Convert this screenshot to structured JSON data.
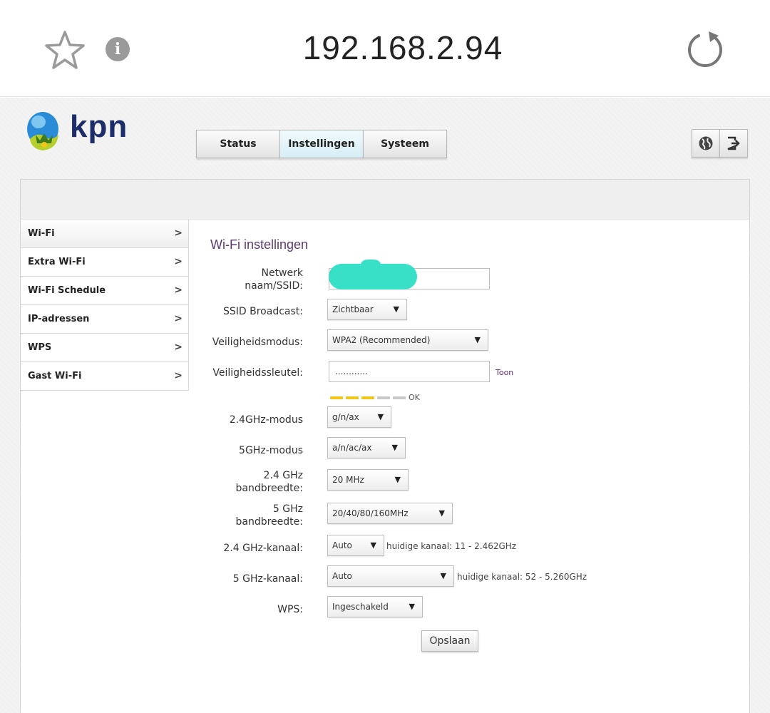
{
  "browser": {
    "url": "192.168.2.94",
    "star_icon": "star-icon",
    "info_icon": "info-icon",
    "info_glyph": "i",
    "reload_icon": "reload-icon"
  },
  "brand": {
    "name": "kpn",
    "logo_icon": "kpn-crown-logo"
  },
  "tabs": [
    {
      "label": "Status"
    },
    {
      "label": "Instellingen",
      "active": true
    },
    {
      "label": "Systeem"
    }
  ],
  "top_icons": [
    "globe-icon",
    "logout-icon"
  ],
  "sidebar": {
    "items": [
      {
        "label": "Wi-Fi",
        "active": true
      },
      {
        "label": "Extra Wi-Fi"
      },
      {
        "label": "Wi-Fi Schedule"
      },
      {
        "label": "IP-adressen"
      },
      {
        "label": "WPS"
      },
      {
        "label": "Gast Wi-Fi"
      }
    ],
    "arrow": ">"
  },
  "wifi": {
    "title": "Wi-Fi instellingen",
    "fields": {
      "ssid": {
        "label_line1": "Netwerk",
        "label_line2": "naam/SSID:",
        "value": ""
      },
      "broadcast": {
        "label": "SSID Broadcast:",
        "value": "Zichtbaar"
      },
      "security_mode": {
        "label": "Veiligheidsmodus:",
        "value": "WPA2 (Recommended)"
      },
      "security_key": {
        "label": "Veiligheidssleutel:",
        "value": "............",
        "show_label": "Toon"
      },
      "strength": {
        "label": "OK",
        "filled": 3,
        "total": 5,
        "filled_color": "#f0c419",
        "empty_color": "#c8c8c8"
      },
      "mode_24": {
        "label": "2.4GHz-modus",
        "value": "g/n/ax"
      },
      "mode_5": {
        "label": "5GHz-modus",
        "value": "a/n/ac/ax"
      },
      "bw_24": {
        "label_line1": "2.4 GHz",
        "label_line2": "bandbreedte:",
        "value": "20 MHz"
      },
      "bw_5": {
        "label_line1": "5 GHz",
        "label_line2": "bandbreedte:",
        "value": "20/40/80/160MHz"
      },
      "channel_24": {
        "label": "2.4 GHz-kanaal:",
        "value": "Auto",
        "hint": "huidige kanaal: 11 - 2.462GHz"
      },
      "channel_5": {
        "label": "5 GHz-kanaal:",
        "value": "Auto",
        "hint": "huidige kanaal: 52 - 5.260GHz"
      },
      "wps": {
        "label": "WPS:",
        "value": "Ingeschakeld"
      }
    },
    "dropdown_arrow": "▼",
    "save_label": "Opslaan"
  },
  "colors": {
    "accent_purple": "#5b3b6e",
    "redaction": "#39e0c8",
    "brand_blue": "#1d2d6b"
  }
}
